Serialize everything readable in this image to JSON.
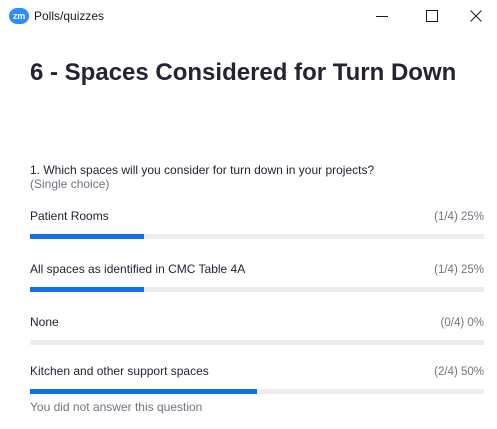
{
  "window": {
    "app_icon_text": "zm",
    "title": "Polls/quizzes"
  },
  "poll": {
    "title": "6 - Spaces Considered for Turn Down",
    "question": "1. Which spaces will you consider for turn down in your projects?",
    "question_type": "(Single choice)",
    "options": [
      {
        "label": "Patient Rooms",
        "result": "(1/4) 25%",
        "fraction": 0.25
      },
      {
        "label": "All spaces as identified in CMC Table 4A",
        "result": "(1/4) 25%",
        "fraction": 0.25
      },
      {
        "label": "None",
        "result": "(0/4) 0%",
        "fraction": 0
      },
      {
        "label": "Kitchen and other support spaces",
        "result": "(2/4) 50%",
        "fraction": 0.5
      }
    ],
    "footer": "You did not answer this question"
  },
  "colors": {
    "accent": "#0e71eb",
    "track": "#ededf0",
    "app_icon": "#2d8cff"
  },
  "icons": {
    "minimize": "minimize-icon",
    "maximize": "maximize-icon",
    "close": "close-icon"
  }
}
